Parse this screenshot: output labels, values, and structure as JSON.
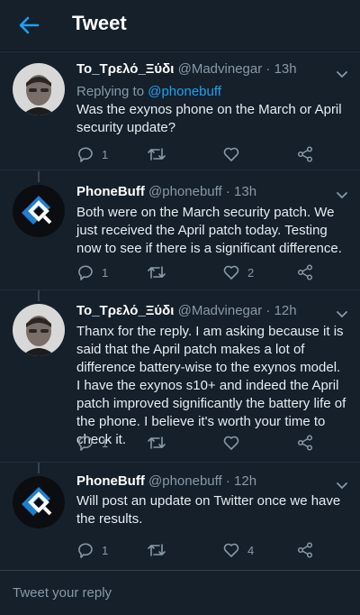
{
  "header": {
    "title": "Tweet"
  },
  "tweets": [
    {
      "name": "Το_Τρελό_Ξύδι",
      "handle": "@Madvinegar",
      "time": "13h",
      "reply_prefix": "Replying to ",
      "reply_mention": "@phonebuff",
      "text": "Was the exynos phone on the March or April security update?",
      "replies": "1",
      "retweets": "",
      "likes": ""
    },
    {
      "name": "PhoneBuff",
      "handle": "@phonebuff",
      "time": "13h",
      "text": "Both were on the March security patch. We just received the April patch today. Testing now to see if there is a significant difference.",
      "replies": "1",
      "retweets": "",
      "likes": "2"
    },
    {
      "name": "Το_Τρελό_Ξύδι",
      "handle": "@Madvinegar",
      "time": "12h",
      "text": "Thanx for the reply. I am asking because it is said that the April patch makes a lot of difference battery-wise to the exynos model. I have the exynos s10+ and indeed the April patch improved significantly the battery life of the phone. I believe it's worth your time to check it.",
      "replies": "1",
      "retweets": "",
      "likes": ""
    },
    {
      "name": "PhoneBuff",
      "handle": "@phonebuff",
      "time": "12h",
      "text": "Will post an update on Twitter once we have the results.",
      "replies": "1",
      "retweets": "",
      "likes": "4"
    }
  ],
  "composer": {
    "placeholder": "Tweet your reply"
  },
  "colors": {
    "background": "#15202b",
    "accent": "#1da1f2",
    "muted": "#8899a6",
    "text": "#e6ecf0"
  }
}
